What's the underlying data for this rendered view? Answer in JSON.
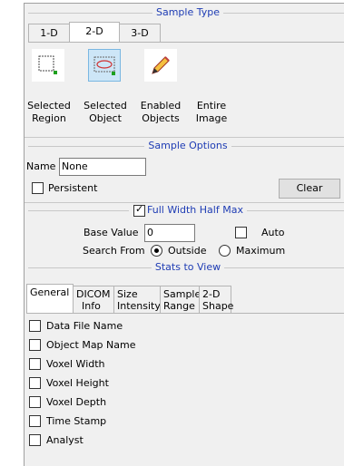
{
  "sample_type": {
    "title": "Sample Type",
    "tabs": [
      {
        "label": "1-D"
      },
      {
        "label": "2-D"
      },
      {
        "label": "3-D"
      }
    ],
    "buttons": [
      {
        "label_line1": "Selected",
        "label_line2": "Region",
        "icon": "selected-region-icon"
      },
      {
        "label_line1": "Selected",
        "label_line2": "Object",
        "icon": "selected-object-icon"
      },
      {
        "label_line1": "Enabled",
        "label_line2": "Objects",
        "icon": "pencil-icon"
      },
      {
        "label_line1": "Entire",
        "label_line2": "Image",
        "icon": ""
      }
    ]
  },
  "sample_options": {
    "title": "Sample Options",
    "name_label": "Name",
    "name_value": "None",
    "persistent_label": "Persistent",
    "clear_label": "Clear"
  },
  "fwhm": {
    "label": "Full Width Half Max",
    "base_value_label": "Base Value",
    "base_value": "0",
    "auto_label": "Auto",
    "search_from_label": "Search From",
    "outside_label": "Outside",
    "maximum_label": "Maximum"
  },
  "stats": {
    "title": "Stats to View",
    "tabs": [
      {
        "line1": "General",
        "line2": ""
      },
      {
        "line1": "DICOM",
        "line2": "Info"
      },
      {
        "line1": "Size",
        "line2": "Intensity"
      },
      {
        "line1": "Sample",
        "line2": "Range"
      },
      {
        "line1": "2-D",
        "line2": "Shape"
      }
    ],
    "items": [
      "Data File Name",
      "Object Map Name",
      "Voxel Width",
      "Voxel Height",
      "Voxel Depth",
      "Time Stamp",
      "Analyst"
    ]
  },
  "colors": {
    "accent_text": "#1e3cb4",
    "selected_bg": "#cde6f7"
  }
}
